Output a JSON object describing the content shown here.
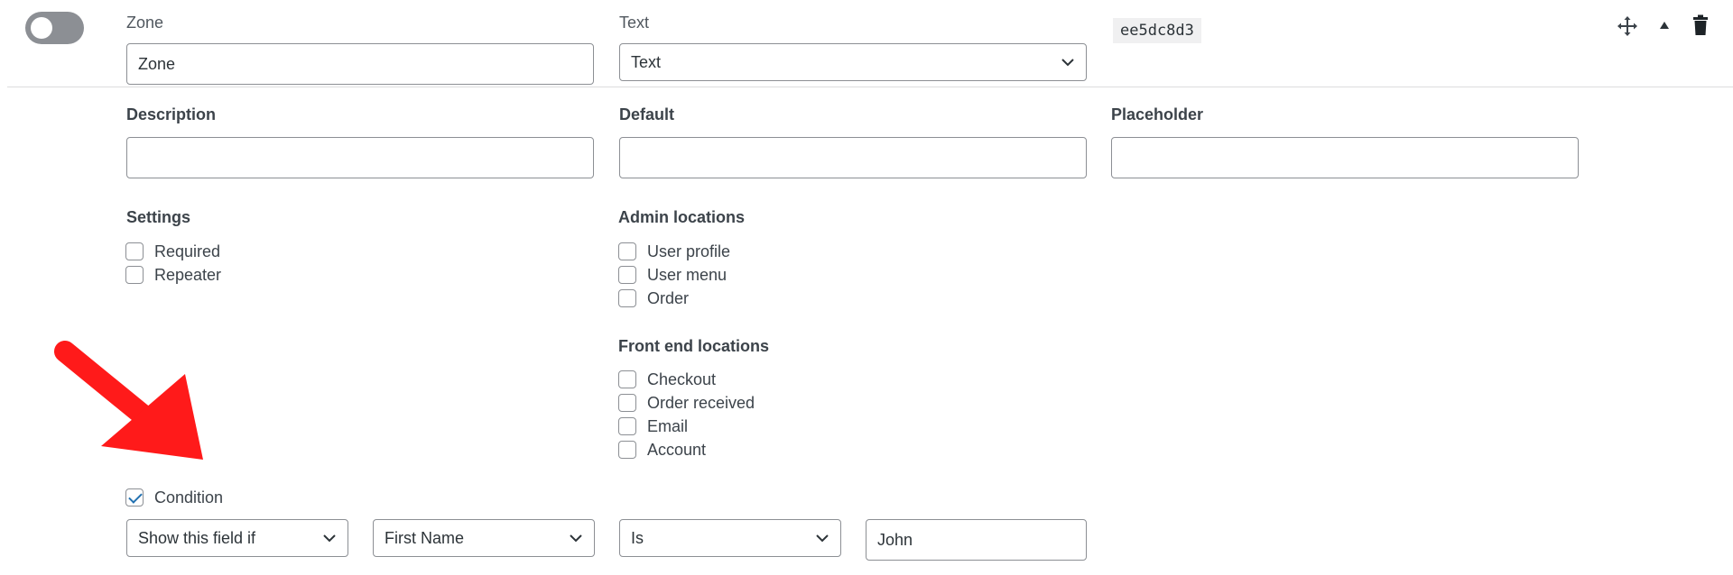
{
  "header": {
    "name_label": "Zone",
    "name_value": "Zone",
    "type_label": "Text",
    "type_value": "Text",
    "hash": "ee5dc8d3",
    "icons": {
      "move": "move-arrows-icon",
      "collapse": "triangle-up-icon",
      "delete": "trash-icon"
    }
  },
  "fields": {
    "description_label": "Description",
    "description_value": "",
    "default_label": "Default",
    "default_value": "",
    "placeholder_label": "Placeholder",
    "placeholder_value": ""
  },
  "settings": {
    "title": "Settings",
    "items": [
      {
        "label": "Required",
        "checked": false
      },
      {
        "label": "Repeater",
        "checked": false
      }
    ]
  },
  "admin_locations": {
    "title": "Admin locations",
    "items": [
      {
        "label": "User profile",
        "checked": false
      },
      {
        "label": "User menu",
        "checked": false
      },
      {
        "label": "Order",
        "checked": false
      }
    ]
  },
  "front_end_locations": {
    "title": "Front end locations",
    "items": [
      {
        "label": "Checkout",
        "checked": false
      },
      {
        "label": "Order received",
        "checked": false
      },
      {
        "label": "Email",
        "checked": false
      },
      {
        "label": "Account",
        "checked": false
      }
    ]
  },
  "condition": {
    "label": "Condition",
    "checked": true,
    "action_value": "Show this field if",
    "field_value": "First Name",
    "operator_value": "Is",
    "compare_value": "John"
  },
  "colors": {
    "toggle_off": "#8c8f94",
    "border": "#8c8f94",
    "check": "#2271b1",
    "annotation_arrow": "#ff1a1a",
    "hash_bg": "#f0f0f1"
  }
}
